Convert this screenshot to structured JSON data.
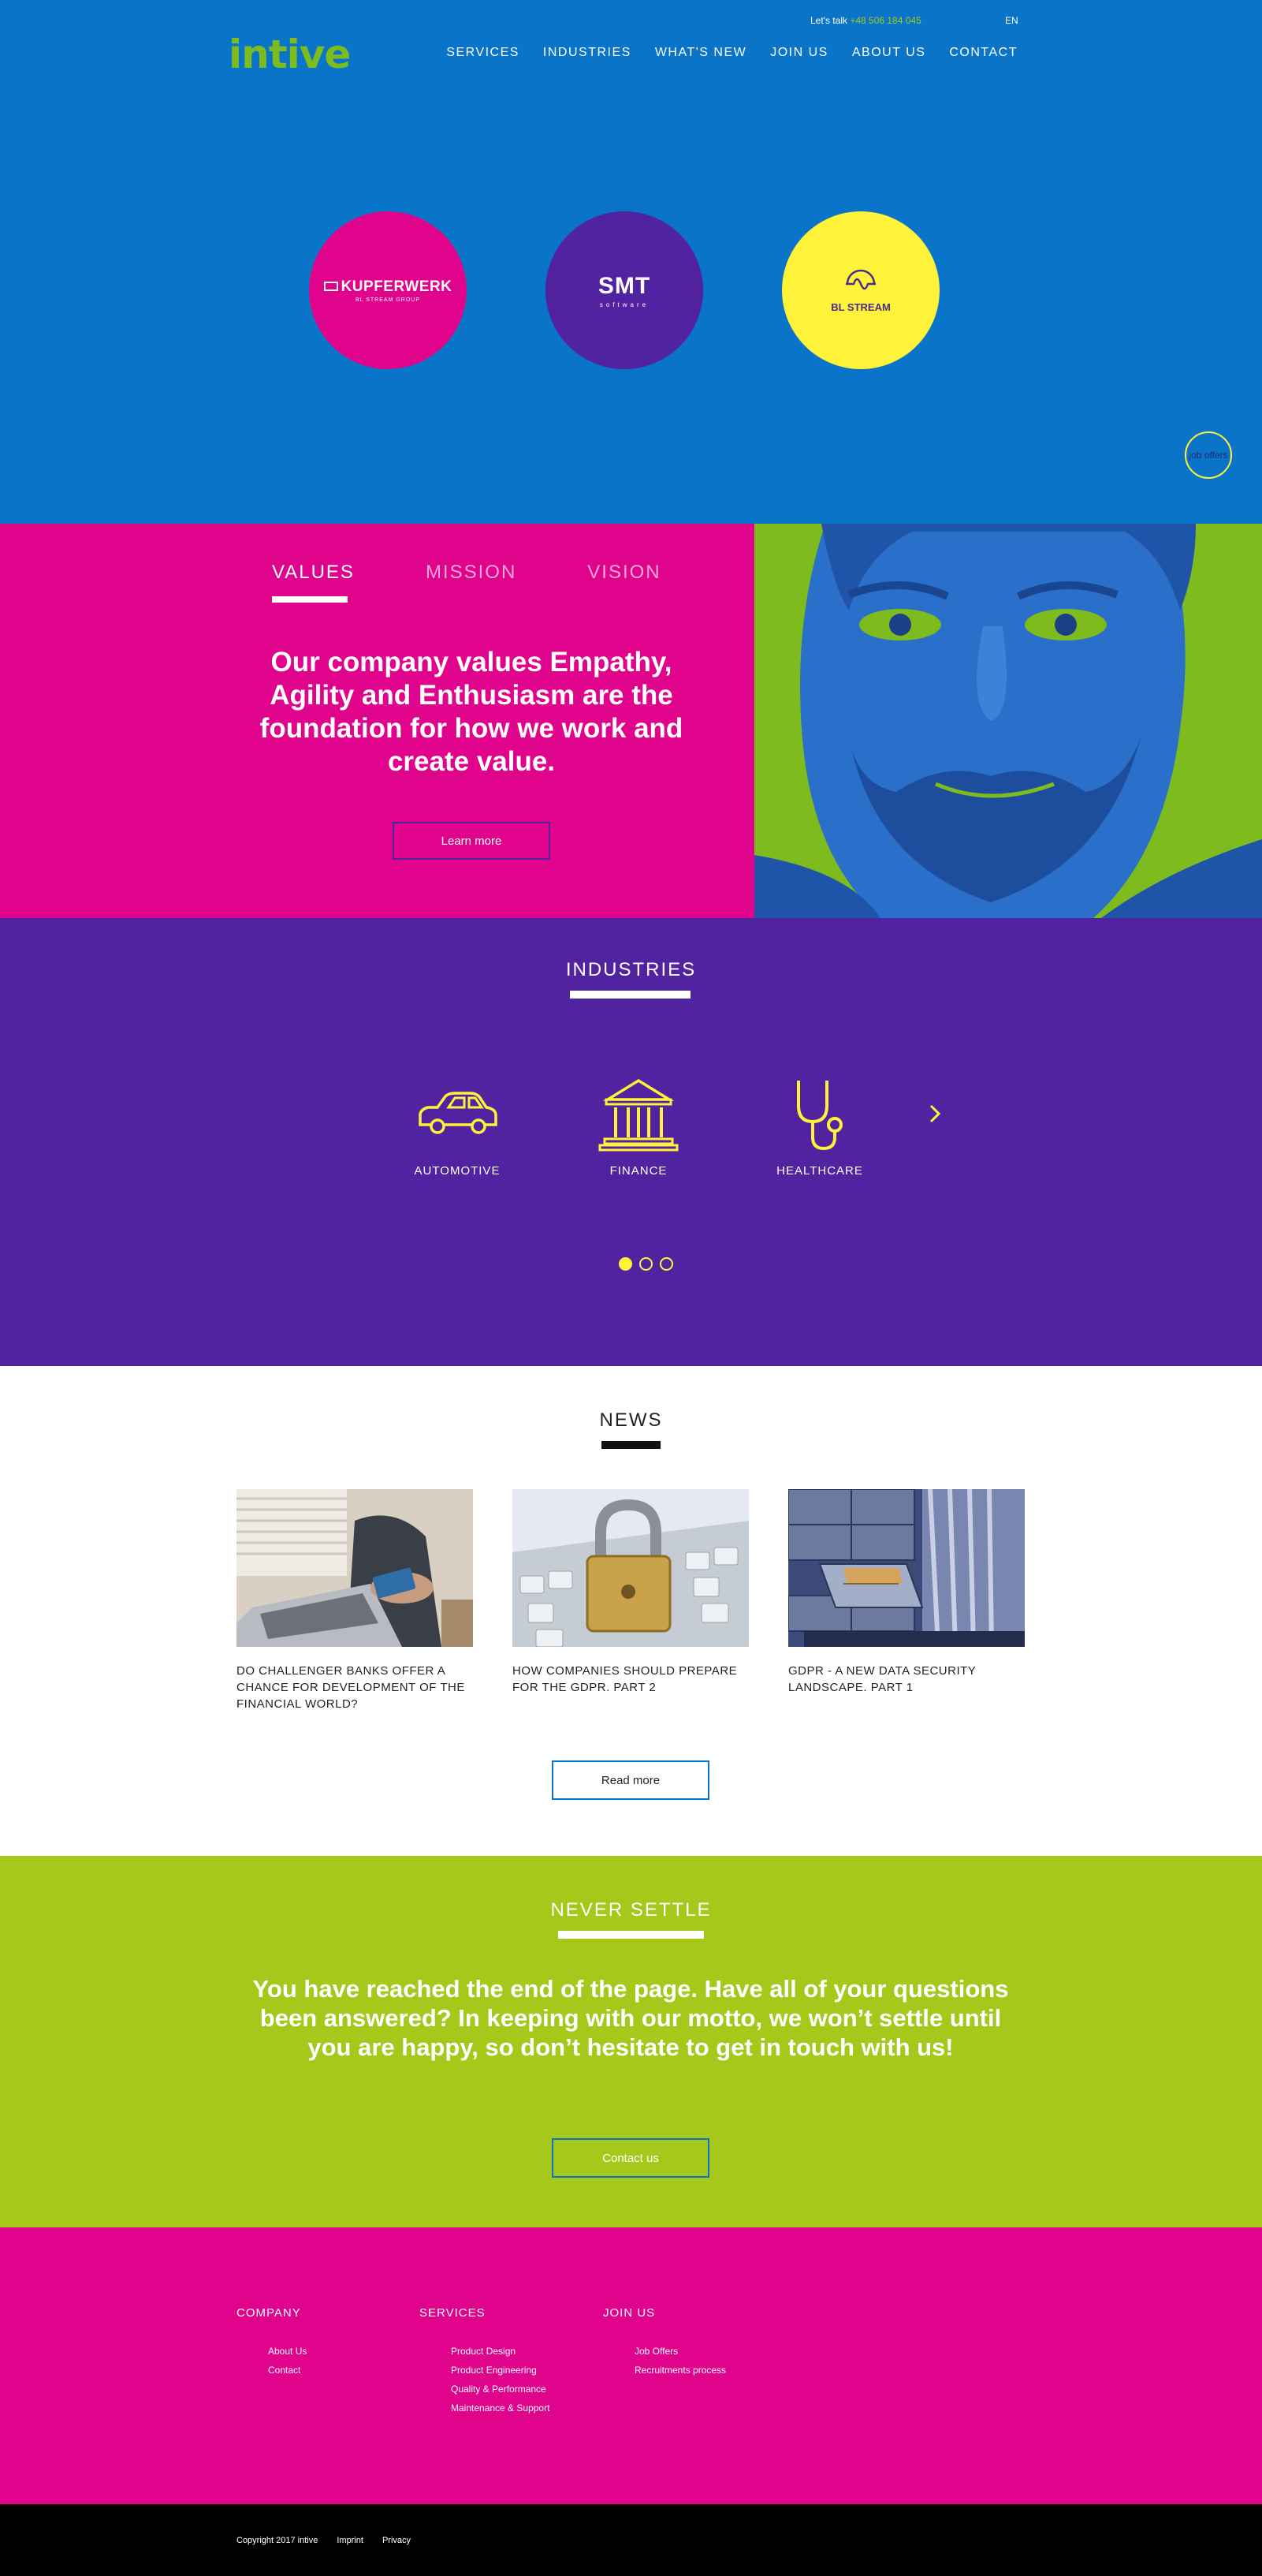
{
  "header": {
    "logo": "intive",
    "talk_label": "Let's talk",
    "phone": "+48 506 184 045",
    "lang": "EN",
    "nav": [
      "SERVICES",
      "INDUSTRIES",
      "WHAT'S NEW",
      "JOIN US",
      "ABOUT US",
      "CONTACT"
    ]
  },
  "hero": {
    "brands": [
      {
        "name": "KUPFERWERK",
        "sub": "BL STREAM GROUP"
      },
      {
        "name": "SMT",
        "sub": "software"
      },
      {
        "name": "BL STREAM"
      }
    ],
    "job_badge": "job offers"
  },
  "values": {
    "tabs": [
      "VALUES",
      "MISSION",
      "VISION"
    ],
    "active_tab": "VALUES",
    "text": "Our company values Empathy, Agility and Enthusiasm are the foundation for how we work and create value.",
    "button": "Learn more"
  },
  "industries": {
    "title": "INDUSTRIES",
    "items": [
      {
        "label": "AUTOMOTIVE",
        "icon": "car-icon"
      },
      {
        "label": "FINANCE",
        "icon": "bank-icon"
      },
      {
        "label": "HEALTHCARE",
        "icon": "stethoscope-icon"
      }
    ],
    "page_count": 3,
    "active_page": 1
  },
  "news": {
    "title": "NEWS",
    "articles": [
      {
        "title": "DO CHALLENGER BANKS OFFER A CHANCE FOR DEVELOPMENT OF THE FINANCIAL WORLD?"
      },
      {
        "title": "HOW COMPANIES SHOULD PREPARE FOR THE GDPR. PART 2"
      },
      {
        "title": "GDPR - A NEW DATA SECURITY LANDSCAPE. PART 1"
      }
    ],
    "button": "Read more"
  },
  "settle": {
    "title": "NEVER SETTLE",
    "text": "You have reached the end of the page. Have all of your questions been answered? In keeping with our motto, we won’t settle until you are happy, so don’t hesitate to get in touch with us!",
    "button": "Contact us"
  },
  "footer": {
    "columns": [
      {
        "head": "COMPANY",
        "links": [
          "About Us",
          "Contact"
        ]
      },
      {
        "head": "SERVICES",
        "links": [
          "Product Design",
          "Product Engineering",
          "Quality & Performance",
          "Maintenance & Support"
        ]
      },
      {
        "head": "JOIN US",
        "links": [
          "Job Offers",
          "Recruitments process"
        ]
      }
    ],
    "copyright": "Copyright 2017 intive",
    "imprint": "Imprint",
    "privacy": "Privacy"
  },
  "colors": {
    "blue": "#0a74c9",
    "magenta": "#e0048c",
    "purple": "#5223a0",
    "yellow": "#fff33a",
    "lime": "#a6c81b",
    "green": "#7dbb1e"
  }
}
